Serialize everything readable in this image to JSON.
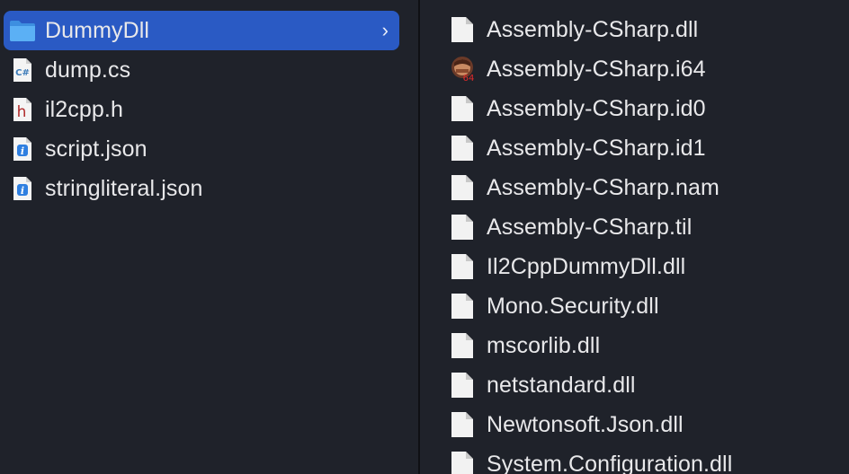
{
  "left_column": {
    "items": [
      {
        "label": "DummyDll",
        "icon": "folder-icon",
        "selected": true,
        "expandable": true
      },
      {
        "label": "dump.cs",
        "icon": "csharp-file-icon",
        "selected": false
      },
      {
        "label": "il2cpp.h",
        "icon": "header-file-icon",
        "selected": false
      },
      {
        "label": "script.json",
        "icon": "json-file-icon",
        "selected": false
      },
      {
        "label": "stringliteral.json",
        "icon": "json-file-icon",
        "selected": false
      }
    ],
    "chevron": "›"
  },
  "right_column": {
    "items": [
      {
        "label": "Assembly-CSharp.dll",
        "icon": "document-icon"
      },
      {
        "label": "Assembly-CSharp.i64",
        "icon": "ida-database-icon"
      },
      {
        "label": "Assembly-CSharp.id0",
        "icon": "document-icon"
      },
      {
        "label": "Assembly-CSharp.id1",
        "icon": "document-icon"
      },
      {
        "label": "Assembly-CSharp.nam",
        "icon": "document-icon"
      },
      {
        "label": "Assembly-CSharp.til",
        "icon": "document-icon"
      },
      {
        "label": "Il2CppDummyDll.dll",
        "icon": "document-icon"
      },
      {
        "label": "Mono.Security.dll",
        "icon": "document-icon"
      },
      {
        "label": "mscorlib.dll",
        "icon": "document-icon"
      },
      {
        "label": "netstandard.dll",
        "icon": "document-icon"
      },
      {
        "label": "Newtonsoft.Json.dll",
        "icon": "document-icon"
      },
      {
        "label": "System.Configuration.dll",
        "icon": "document-icon"
      }
    ]
  },
  "icon_text": {
    "csharp": "C#",
    "header": "h",
    "json": "i",
    "ida_badge": "64"
  },
  "colors": {
    "background": "#1f222a",
    "selection": "#2a5ac4",
    "text": "#e8e8ea",
    "folder_blue": "#4aa3f0"
  }
}
